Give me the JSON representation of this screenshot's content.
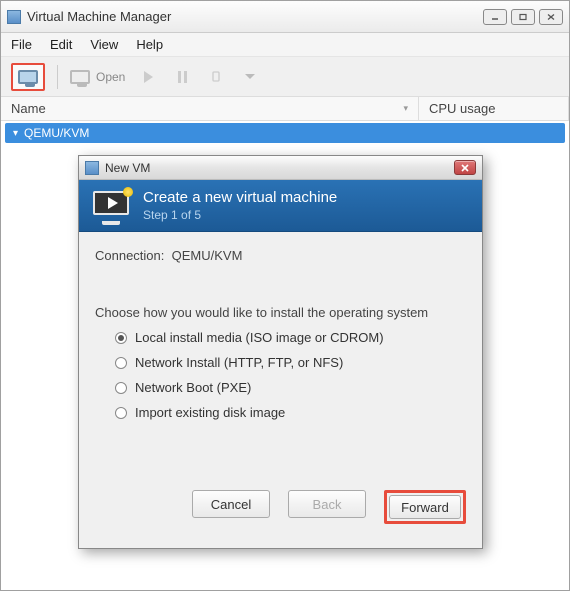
{
  "main_window": {
    "title": "Virtual Machine Manager",
    "menu": {
      "file": "File",
      "edit": "Edit",
      "view": "View",
      "help": "Help"
    },
    "toolbar": {
      "open_label": "Open"
    },
    "columns": {
      "name": "Name",
      "cpu": "CPU usage"
    },
    "tree": {
      "connection": "QEMU/KVM"
    }
  },
  "dialog": {
    "title": "New VM",
    "header_title": "Create a new virtual machine",
    "header_step": "Step 1 of 5",
    "connection_label": "Connection:",
    "connection_value": "QEMU/KVM",
    "choose_label": "Choose how you would like to install the operating system",
    "options": {
      "local": "Local install media (ISO image or CDROM)",
      "network_install": "Network Install (HTTP, FTP, or NFS)",
      "network_boot": "Network Boot (PXE)",
      "import": "Import existing disk image"
    },
    "buttons": {
      "cancel": "Cancel",
      "back": "Back",
      "forward": "Forward"
    }
  }
}
